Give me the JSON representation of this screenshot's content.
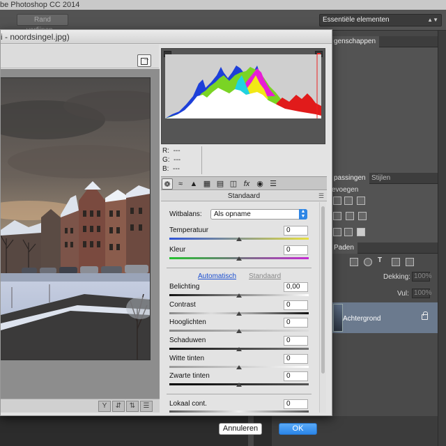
{
  "app": {
    "title": "be Photoshop CC 2014",
    "refine_button": "Rand verfijnen...",
    "workspace_select": "Essentiële elementen"
  },
  "right_panels": {
    "properties_tab": "genschappen",
    "adjustments_label": "evoegen",
    "layers_tabs": [
      "passingen",
      "Stijlen"
    ],
    "paths_tab": "Paden",
    "opacity_label": "Dekking:",
    "opacity_value": "100%",
    "fill_label": "Vul:",
    "fill_value": "100%",
    "layer_name": "Achtergrond"
  },
  "dialog": {
    "title": "i - noordsingel.jpg)",
    "rgb": {
      "r_label": "R:",
      "r_value": "---",
      "g_label": "G:",
      "g_value": "---",
      "b_label": "B:",
      "b_value": "---"
    },
    "section_title": "Standaard",
    "white_balance": {
      "label": "Witbalans:",
      "value": "Als opname"
    },
    "temperature": {
      "label": "Temperatuur",
      "value": "0",
      "level": 0
    },
    "tint": {
      "label": "Kleur",
      "value": "0",
      "level": 0
    },
    "auto_link": "Automatisch",
    "default_link": "Standaard",
    "sliders": [
      {
        "label": "Belichting",
        "value": "0,00",
        "level": 0
      },
      {
        "label": "Contrast",
        "value": "0",
        "level": 0
      },
      {
        "label": "Hooglichten",
        "value": "0",
        "level": 0
      },
      {
        "label": "Schaduwen",
        "value": "0",
        "level": 0
      },
      {
        "label": "Witte tinten",
        "value": "0",
        "level": 0
      },
      {
        "label": "Zwarte tinten",
        "value": "0",
        "level": 0
      }
    ],
    "clarity": {
      "label": "Lokaal cont.",
      "value": "0"
    },
    "cancel_button": "Annuleren",
    "ok_button": "OK",
    "tab_icons": [
      "basic-icon",
      "tone-curve-icon",
      "detail-icon",
      "hsl-icon",
      "split-toning-icon",
      "lens-icon",
      "fx-icon",
      "camera-calibration-icon",
      "presets-icon"
    ]
  }
}
